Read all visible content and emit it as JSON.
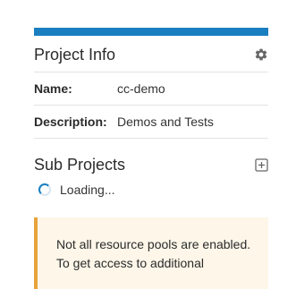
{
  "colors": {
    "accent": "#1a7fc1",
    "alert_border": "#e8a33b",
    "alert_background": "#fdf6e9",
    "icon": "#666666"
  },
  "project_info": {
    "title": "Project Info",
    "settings_icon": "gear-icon",
    "fields": [
      {
        "label": "Name:",
        "value": "cc-demo"
      },
      {
        "label": "Description:",
        "value": "Demos and Tests"
      }
    ]
  },
  "sub_projects": {
    "title": "Sub Projects",
    "add_icon": "add-box-icon",
    "loading_text": "Loading..."
  },
  "alert": {
    "line1": "Not all resource pools are enabled.",
    "line2": "To get access to additional"
  }
}
